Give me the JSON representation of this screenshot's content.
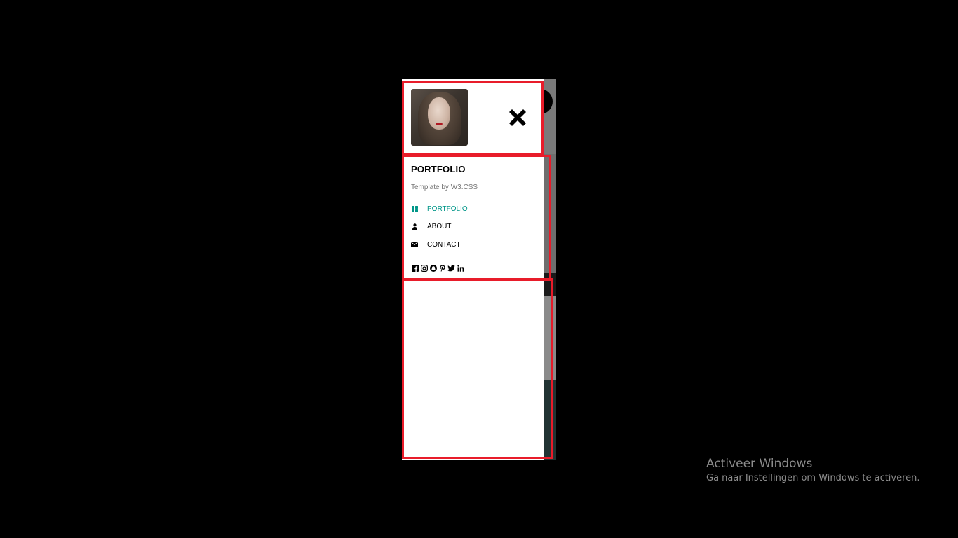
{
  "sidebar": {
    "title": "PORTFOLIO",
    "subtitle": "Template by W3.CSS",
    "close_icon": "close-icon",
    "avatar_alt": "profile-avatar",
    "nav": [
      {
        "label": "PORTFOLIO",
        "icon": "grid-icon",
        "active": true
      },
      {
        "label": "ABOUT",
        "icon": "user-icon",
        "active": false
      },
      {
        "label": "CONTACT",
        "icon": "envelope-icon",
        "active": false
      }
    ],
    "social_icons": [
      "facebook-icon",
      "instagram-icon",
      "snapchat-icon",
      "pinterest-icon",
      "twitter-icon",
      "linkedin-icon"
    ]
  },
  "colors": {
    "highlight": "#e81c2a",
    "active_nav": "#009688",
    "background": "#000000"
  },
  "watermark": {
    "title": "Activeer Windows",
    "subtitle": "Ga naar Instellingen om Windows te activeren."
  }
}
